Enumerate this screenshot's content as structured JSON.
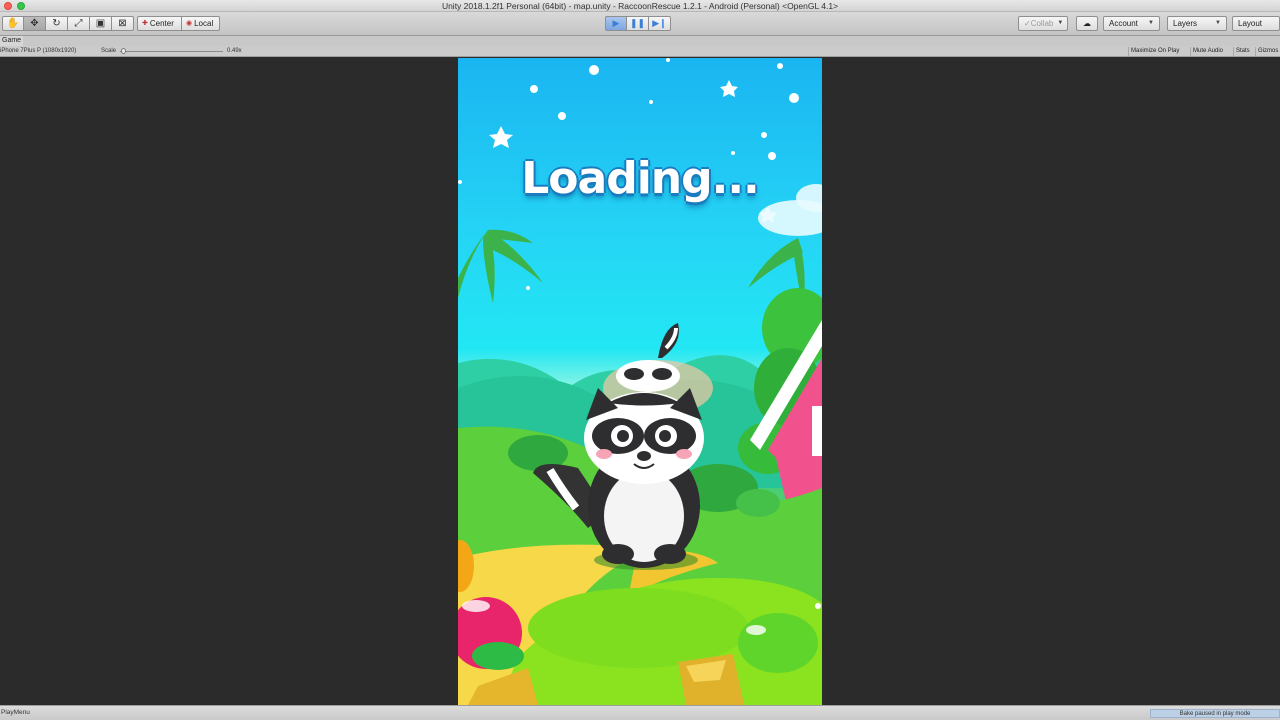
{
  "window": {
    "title": "Unity 2018.1.2f1 Personal (64bit) - map.unity - RaccoonRescue 1.2.1 - Android (Personal) <OpenGL 4.1>"
  },
  "toolbar": {
    "tools": [
      "hand-tool-icon",
      "move-tool-icon",
      "rotate-tool-icon",
      "scale-tool-icon",
      "rect-tool-icon",
      "transform-tool-icon"
    ],
    "pivot_label": "Center",
    "space_label": "Local",
    "collab_label": "Collab",
    "account_label": "Account",
    "layers_label": "Layers",
    "layout_label": "Layout"
  },
  "game_view": {
    "tab_label": "Game",
    "resolution": "iPhone 7Plus P (1080x1920)",
    "scale_label": "Scale",
    "scale_value": "0.49x",
    "maximize_on_play": "Maximize On Play",
    "mute_audio": "Mute Audio",
    "stats": "Stats",
    "gizmos": "Gizmos"
  },
  "game": {
    "loading_text": "Loading...",
    "colors": {
      "sky_top": "#1ab5f1",
      "sky_mid": "#22e7f3",
      "grass": "#6bd74c",
      "text_outline": "#1a7cc0"
    }
  },
  "statusbar": {
    "left_text": "PlayMenu",
    "right_text": "Bake paused in play mode"
  }
}
